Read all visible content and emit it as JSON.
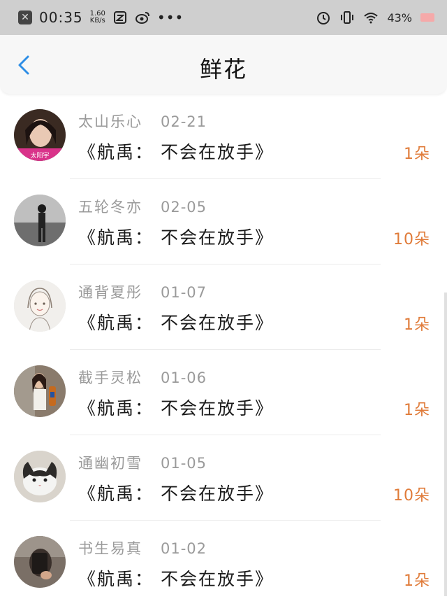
{
  "status_bar": {
    "notification_icon": "close-icon",
    "time": "00:35",
    "speed_value": "1.60",
    "speed_unit": "KB/s",
    "app_icons": [
      "qq-icon",
      "weibo-icon"
    ],
    "more": "•••",
    "right_icons": [
      "alarm-icon",
      "vibrate-icon",
      "wifi-icon"
    ],
    "battery_pct": "43%",
    "battery_color": "#f5a9a9"
  },
  "nav": {
    "back_icon": "chevron-left-icon",
    "title": "鲜花"
  },
  "colors": {
    "accent": "#2e8ee6",
    "count": "#e07b39",
    "sender": "#9a9a9a"
  },
  "items": [
    {
      "name": "太山乐心",
      "date": "02-21",
      "message": "《航禹： 不会在放手》",
      "count": "1朵",
      "avatar": "avatar-woman-photo",
      "avatar_caption": "太阳宇"
    },
    {
      "name": "五轮冬亦",
      "date": "02-05",
      "message": "《航禹： 不会在放手》",
      "count": "10朵",
      "avatar": "avatar-man-bw-photo"
    },
    {
      "name": "通背夏彤",
      "date": "01-07",
      "message": "《航禹： 不会在放手》",
      "count": "1朵",
      "avatar": "avatar-girl-sketch"
    },
    {
      "name": "截手灵松",
      "date": "01-06",
      "message": "《航禹： 不会在放手》",
      "count": "1朵",
      "avatar": "avatar-girl-bottle-photo"
    },
    {
      "name": "通幽初雪",
      "date": "01-05",
      "message": "《航禹： 不会在放手》",
      "count": "10朵",
      "avatar": "avatar-cat-photo"
    },
    {
      "name": "书生易真",
      "date": "01-02",
      "message": "《航禹： 不会在放手》",
      "count": "1朵",
      "avatar": "avatar-phone-selfie"
    }
  ]
}
